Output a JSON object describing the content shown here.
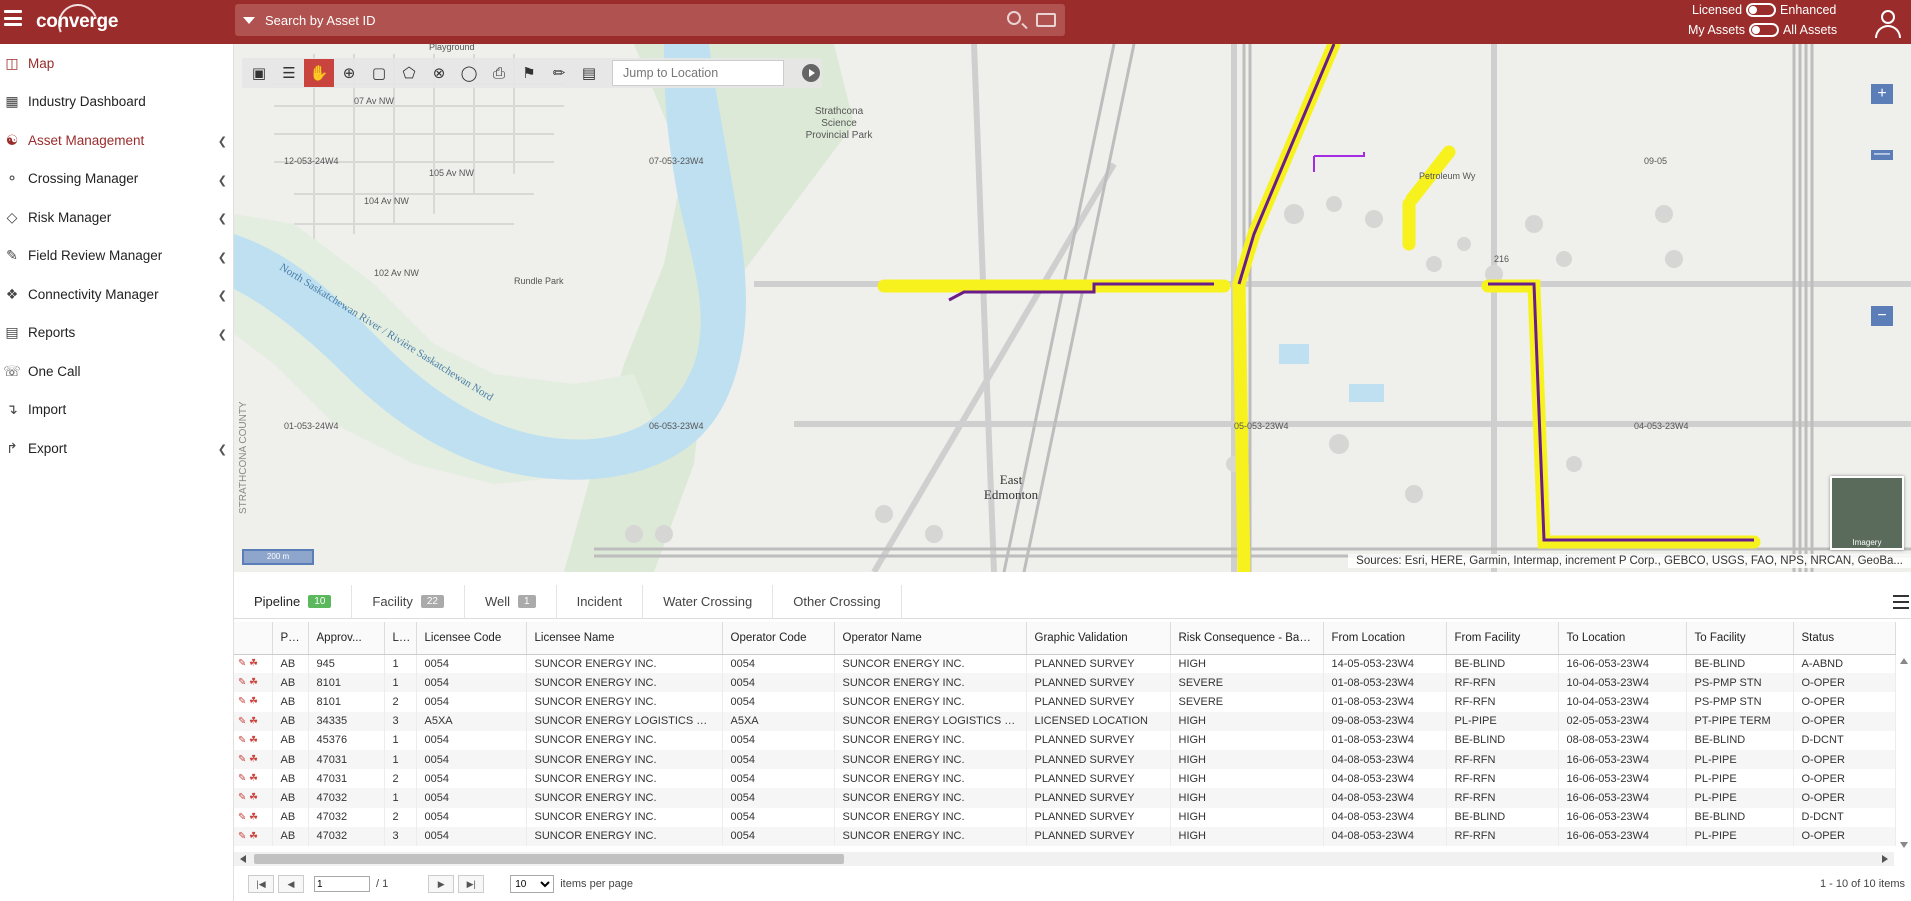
{
  "header": {
    "logo": "converge",
    "search_placeholder": "Search by Asset ID",
    "licensed": "Licensed",
    "enhanced": "Enhanced",
    "my_assets": "My Assets",
    "all_assets": "All Assets"
  },
  "sidebar": {
    "items": [
      {
        "label": "Map",
        "icon": "map-icon"
      },
      {
        "label": "Industry Dashboard",
        "icon": "dashboard-icon"
      },
      {
        "label": "Asset Management",
        "icon": "asset-icon"
      },
      {
        "label": "Crossing Manager",
        "icon": "crossing-icon"
      },
      {
        "label": "Risk Manager",
        "icon": "risk-icon"
      },
      {
        "label": "Field Review Manager",
        "icon": "field-review-icon"
      },
      {
        "label": "Connectivity Manager",
        "icon": "connectivity-icon"
      },
      {
        "label": "Reports",
        "icon": "reports-icon"
      },
      {
        "label": "One Call",
        "icon": "phone-icon"
      },
      {
        "label": "Import",
        "icon": "import-icon"
      },
      {
        "label": "Export",
        "icon": "export-icon"
      }
    ]
  },
  "map": {
    "jump_placeholder": "Jump to Location",
    "scale_label": "200 m",
    "attribution": "Sources: Esri, HERE, Garmin, Intermap, increment P Corp., GEBCO, USGS, FAO, NPS, NRCAN, GeoBa...",
    "minimap_label": "Imagery",
    "labels": {
      "playground": "Playground",
      "ave107": "07 Av NW",
      "ave105": "105 Av NW",
      "ave104": "104 Av NW",
      "ave102": "102 Av NW",
      "grid1": "12-053-24W4",
      "grid2": "07-053-23W4",
      "grid3": "09-05",
      "grid4": "01-053-24W4",
      "grid5": "06-053-23W4",
      "grid6": "05-053-23W4",
      "grid7": "04-053-23W4",
      "park1": "Strathcona",
      "park2": "Science",
      "park3": "Provincial Park",
      "rundle": "Rundle Park",
      "river": "North Saskatchewan River / Rivière Saskatchewan Nord",
      "petroleum": "Petroleum Wy",
      "east1": "East",
      "east2": "Edmonton",
      "county": "STRATHCONA COUNTY",
      "highway": "216"
    }
  },
  "tabs": [
    {
      "label": "Pipeline",
      "badge": "10"
    },
    {
      "label": "Facility",
      "badge": "22"
    },
    {
      "label": "Well",
      "badge": "1"
    },
    {
      "label": "Incident",
      "badge": ""
    },
    {
      "label": "Water Crossing",
      "badge": ""
    },
    {
      "label": "Other Crossing",
      "badge": ""
    }
  ],
  "grid": {
    "columns": [
      "Prov",
      "Approv...",
      "L...",
      "Licensee Code",
      "Licensee Name",
      "Operator Code",
      "Operator Name",
      "Graphic Validation",
      "Risk Consequence - Base...",
      "From Location",
      "From Facility",
      "To Location",
      "To Facility",
      "Status"
    ],
    "rows": [
      [
        "AB",
        "945",
        "1",
        "0054",
        "SUNCOR ENERGY INC.",
        "0054",
        "SUNCOR ENERGY INC.",
        "PLANNED SURVEY",
        "HIGH",
        "14-05-053-23W4",
        "BE-BLIND",
        "16-06-053-23W4",
        "BE-BLIND",
        "A-ABND"
      ],
      [
        "AB",
        "8101",
        "1",
        "0054",
        "SUNCOR ENERGY INC.",
        "0054",
        "SUNCOR ENERGY INC.",
        "PLANNED SURVEY",
        "SEVERE",
        "01-08-053-23W4",
        "RF-RFN",
        "10-04-053-23W4",
        "PS-PMP STN",
        "O-OPER"
      ],
      [
        "AB",
        "8101",
        "2",
        "0054",
        "SUNCOR ENERGY INC.",
        "0054",
        "SUNCOR ENERGY INC.",
        "PLANNED SURVEY",
        "SEVERE",
        "01-08-053-23W4",
        "RF-RFN",
        "10-04-053-23W4",
        "PS-PMP STN",
        "O-OPER"
      ],
      [
        "AB",
        "34335",
        "3",
        "A5XA",
        "SUNCOR ENERGY LOGISTICS CORPORATION",
        "A5XA",
        "SUNCOR ENERGY LOGISTICS CORPORATION",
        "LICENSED LOCATION",
        "HIGH",
        "09-08-053-23W4",
        "PL-PIPE",
        "02-05-053-23W4",
        "PT-PIPE TERM",
        "O-OPER"
      ],
      [
        "AB",
        "45376",
        "1",
        "0054",
        "SUNCOR ENERGY INC.",
        "0054",
        "SUNCOR ENERGY INC.",
        "PLANNED SURVEY",
        "HIGH",
        "01-08-053-23W4",
        "BE-BLIND",
        "08-08-053-23W4",
        "BE-BLIND",
        "D-DCNT"
      ],
      [
        "AB",
        "47031",
        "1",
        "0054",
        "SUNCOR ENERGY INC.",
        "0054",
        "SUNCOR ENERGY INC.",
        "PLANNED SURVEY",
        "HIGH",
        "04-08-053-23W4",
        "RF-RFN",
        "16-06-053-23W4",
        "PL-PIPE",
        "O-OPER"
      ],
      [
        "AB",
        "47031",
        "2",
        "0054",
        "SUNCOR ENERGY INC.",
        "0054",
        "SUNCOR ENERGY INC.",
        "PLANNED SURVEY",
        "HIGH",
        "04-08-053-23W4",
        "RF-RFN",
        "16-06-053-23W4",
        "PL-PIPE",
        "O-OPER"
      ],
      [
        "AB",
        "47032",
        "1",
        "0054",
        "SUNCOR ENERGY INC.",
        "0054",
        "SUNCOR ENERGY INC.",
        "PLANNED SURVEY",
        "HIGH",
        "04-08-053-23W4",
        "RF-RFN",
        "16-06-053-23W4",
        "PL-PIPE",
        "O-OPER"
      ],
      [
        "AB",
        "47032",
        "2",
        "0054",
        "SUNCOR ENERGY INC.",
        "0054",
        "SUNCOR ENERGY INC.",
        "PLANNED SURVEY",
        "HIGH",
        "04-08-053-23W4",
        "BE-BLIND",
        "16-06-053-23W4",
        "BE-BLIND",
        "D-DCNT"
      ],
      [
        "AB",
        "47032",
        "3",
        "0054",
        "SUNCOR ENERGY INC.",
        "0054",
        "SUNCOR ENERGY INC.",
        "PLANNED SURVEY",
        "HIGH",
        "04-08-053-23W4",
        "RF-RFN",
        "16-06-053-23W4",
        "PL-PIPE",
        "O-OPER"
      ]
    ]
  },
  "pager": {
    "page_value": "1",
    "page_total": "/ 1",
    "per_page": "10",
    "per_page_label": "items per page",
    "info": "1 - 10 of 10 items"
  },
  "colors": {
    "brand": "#9a2c2b",
    "pipeline_highlight": "#f7f21e",
    "pipeline": "#6a1d8a"
  }
}
